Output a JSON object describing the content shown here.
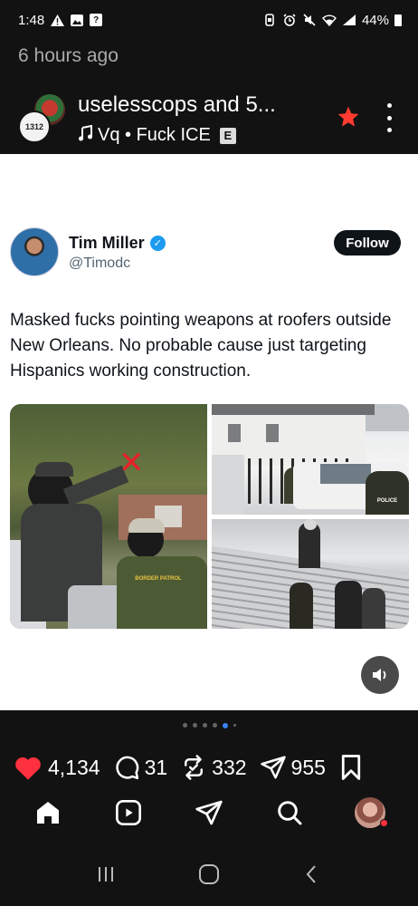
{
  "status_bar": {
    "time": "1:48",
    "battery": "44%"
  },
  "time_ago": "6 hours ago",
  "header": {
    "title": "uselesscops and 5...",
    "audio_label": "Vq • Fuck ICE",
    "explicit_badge": "E",
    "avatar_text": "1312"
  },
  "tweet": {
    "author_name": "Tim Miller",
    "author_handle": "@Timodc",
    "follow_label": "Follow",
    "text": "Masked fucks pointing weapons at roofers outside New Orleans. No probable cause just targeting Hispanics working construction.",
    "patch_text": "BORDER PATROL",
    "police_text": "POLICE"
  },
  "carousel": {
    "active_index": 4
  },
  "actions": {
    "likes": "4,134",
    "comments": "31",
    "reposts": "332",
    "shares": "955"
  },
  "colors": {
    "accent_like": "#ff3040",
    "star": "#ff3b30",
    "verified": "#1d9bf0",
    "dot_active": "#3b82f6"
  }
}
